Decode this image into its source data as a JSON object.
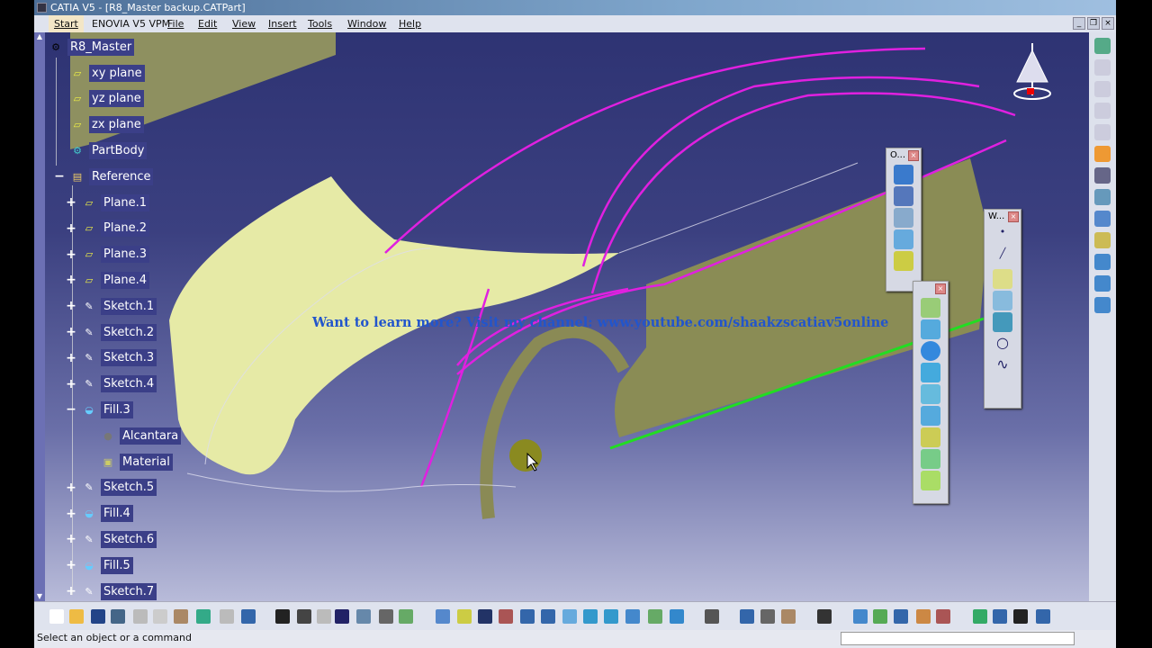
{
  "window": {
    "title": "CATIA V5 - [R8_Master backup.CATPart]"
  },
  "menu": {
    "items": [
      "Start",
      "ENOVIA V5 VPM",
      "File",
      "Edit",
      "View",
      "Insert",
      "Tools",
      "Window",
      "Help"
    ]
  },
  "tree": {
    "root": "R8_Master",
    "nodes": [
      {
        "label": "xy plane",
        "icon": "plane-icon"
      },
      {
        "label": "yz plane",
        "icon": "plane-icon"
      },
      {
        "label": "zx plane",
        "icon": "plane-icon"
      },
      {
        "label": "PartBody",
        "icon": "gear-icon"
      },
      {
        "label": "Reference",
        "icon": "geometrical-set-icon"
      },
      {
        "label": "Plane.1",
        "icon": "plane-icon"
      },
      {
        "label": "Plane.2",
        "icon": "plane-icon"
      },
      {
        "label": "Plane.3",
        "icon": "plane-icon"
      },
      {
        "label": "Plane.4",
        "icon": "plane-icon"
      },
      {
        "label": "Sketch.1",
        "icon": "sketch-icon"
      },
      {
        "label": "Sketch.2",
        "icon": "sketch-icon"
      },
      {
        "label": "Sketch.3",
        "icon": "sketch-icon"
      },
      {
        "label": "Sketch.4",
        "icon": "sketch-icon"
      },
      {
        "label": "Fill.3",
        "icon": "fill-icon"
      },
      {
        "label": "Alcantara",
        "icon": "material-sphere-icon"
      },
      {
        "label": "Material",
        "icon": "material-icon"
      },
      {
        "label": "Sketch.5",
        "icon": "sketch-icon"
      },
      {
        "label": "Fill.4",
        "icon": "fill-icon"
      },
      {
        "label": "Sketch.6",
        "icon": "sketch-icon"
      },
      {
        "label": "Fill.5",
        "icon": "fill-icon"
      },
      {
        "label": "Sketch.7",
        "icon": "sketch-icon"
      }
    ]
  },
  "viewport": {
    "watermark": "Want to learn more? Visit my channel: www.youtube.com/shaakzscatiav5online",
    "colors": {
      "surface": "#e6eaa6",
      "side_surface": "#8a8c55",
      "curves": "#e020e0",
      "boundary": "#22dd22"
    }
  },
  "floating_toolbars": [
    {
      "title": "O..."
    },
    {
      "title": "W..."
    },
    {
      "title": ""
    }
  ],
  "status": {
    "message": "Select an object or a command"
  }
}
